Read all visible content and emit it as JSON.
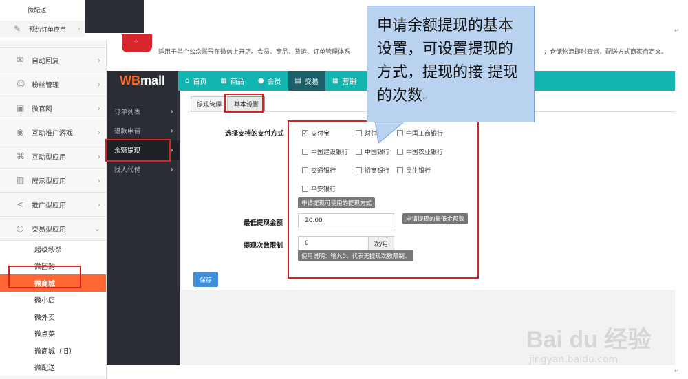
{
  "top_crop": {
    "item1": "微配送",
    "item2": "预约订单应用"
  },
  "left_sidebar": {
    "items": [
      {
        "label": "自动回复",
        "icon": "speech-bubble-icon"
      },
      {
        "label": "粉丝管理",
        "icon": "users-icon"
      },
      {
        "label": "微官网",
        "icon": "website-icon"
      },
      {
        "label": "互动推广游戏",
        "icon": "gamepad-icon"
      },
      {
        "label": "互动型应用",
        "icon": "command-icon"
      },
      {
        "label": "展示型应用",
        "icon": "display-icon"
      },
      {
        "label": "推广型应用",
        "icon": "share-icon"
      },
      {
        "label": "交易型应用",
        "icon": "trade-icon"
      }
    ],
    "subitems": [
      "超级秒杀",
      "微团购",
      "微商城",
      "微小店",
      "微外卖",
      "微点菜",
      "微商城（旧）",
      "微配送"
    ],
    "active_subitem": "微商城"
  },
  "banner": {
    "logo_glyph": "⁘",
    "text": "适用于单个公众账号在微信上开店。会员、商品、货运、订单管理体系",
    "text_tail": "；仓储物流即时查询，配送方式商家自定义。"
  },
  "topnav": {
    "brand_wb": "WB",
    "brand_mall": "mall",
    "items": [
      {
        "label": "首页",
        "icon": "home-icon",
        "glyph": "⌂"
      },
      {
        "label": "商品",
        "icon": "grid-icon",
        "glyph": "▦"
      },
      {
        "label": "会员",
        "icon": "user-icon",
        "glyph": "●"
      },
      {
        "label": "交易",
        "icon": "list-icon",
        "glyph": "▤"
      },
      {
        "label": "营销",
        "icon": "grid-icon",
        "glyph": "▦"
      }
    ],
    "active": "交易"
  },
  "sub_sidebar": {
    "items": [
      "订单列表",
      "退款申请",
      "余额提现",
      "找人代付"
    ],
    "active": "余额提现"
  },
  "tabs": [
    "提现管理",
    "基本设置"
  ],
  "active_tab": "基本设置",
  "form": {
    "payment_label": "选择支持的支付方式",
    "payment_options": [
      {
        "label": "支付宝",
        "checked": true
      },
      {
        "label": "财付通",
        "checked": false
      },
      {
        "label": "中国工商银行",
        "checked": false
      },
      {
        "label": "中国建设银行",
        "checked": false
      },
      {
        "label": "中国银行",
        "checked": false
      },
      {
        "label": "中国农业银行",
        "checked": false
      },
      {
        "label": "交通银行",
        "checked": false
      },
      {
        "label": "招商银行",
        "checked": false
      },
      {
        "label": "民生银行",
        "checked": false
      },
      {
        "label": "平安银行",
        "checked": false
      }
    ],
    "payment_hint": "申请提现可使用的提现方式",
    "min_label": "最低提现金额",
    "min_value": "20.00",
    "min_hint": "申请提现的最低金额数",
    "limit_label": "提现次数限制",
    "limit_value": "0",
    "limit_unit": "次/月",
    "limit_hint": "使用说明：输入0，代表无提现次数限制。",
    "save_label": "保存"
  },
  "callout": {
    "text": "申请余额提现的基本设置，可设置提现的方式，提现的接 提现的次数"
  },
  "return_mark": "↵",
  "watermark": {
    "main": "Bai du 经验",
    "sub": "jingyan.baidu.com"
  },
  "colors": {
    "teal_nav": "#13b5b1",
    "dark_sidebar": "#2a2d33",
    "active_orange": "#ff6633",
    "annotation_red": "#e02020",
    "callout_blue": "#b8d2f0",
    "save_blue": "#3e8fd8"
  }
}
